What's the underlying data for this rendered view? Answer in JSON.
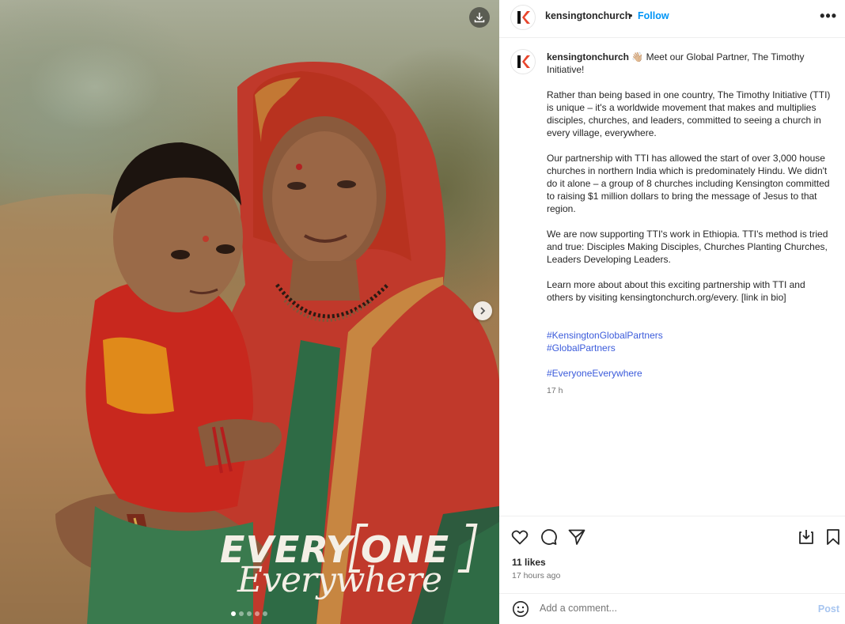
{
  "media": {
    "overlay_word1": "EVERY",
    "overlay_word2": "ONE",
    "overlay_script": "Everywhere",
    "carousel_count": 5,
    "carousel_active": 1
  },
  "header": {
    "username": "kensingtonchurch",
    "separator": "•",
    "follow_label": "Follow",
    "more_label": "•••",
    "logo_letter": "K"
  },
  "caption": {
    "username": "kensingtonchurch",
    "intro": "👋🏼 Meet our Global Partner, The Timothy Initiative!",
    "paragraphs": [
      "Rather than being based in one country, The Timothy Initiative (TTI) is unique – it's a worldwide movement that makes and multiplies disciples, churches, and leaders, committed to seeing a church in every village, everywhere.",
      "Our partnership with TTI has allowed the start of over 3,000 house churches in northern India which is predominately Hindu. We didn't do it alone – a group of 8 churches including Kensington committed to raising $1 million dollars to bring the message of Jesus to that region.",
      "We are now supporting TTI's work in Ethiopia. TTI's method is tried and true: Disciples Making Disciples, Churches Planting Churches, Leaders Developing Leaders.",
      "Learn more about about this exciting partnership with TTI and others by visiting kensingtonchurch.org/every. [link in bio]"
    ],
    "hashtags": [
      "#KensingtonGlobalPartners",
      "#GlobalPartners",
      "#EveryoneEverywhere"
    ],
    "time": "17 h"
  },
  "actions": {
    "likes": "11 likes",
    "ago": "17 hours ago"
  },
  "comment": {
    "placeholder": "Add a comment...",
    "post_label": "Post"
  },
  "colors": {
    "accent": "#0095f6",
    "brand_orange": "#e8452c",
    "hashtag": "#3b5bdb"
  }
}
